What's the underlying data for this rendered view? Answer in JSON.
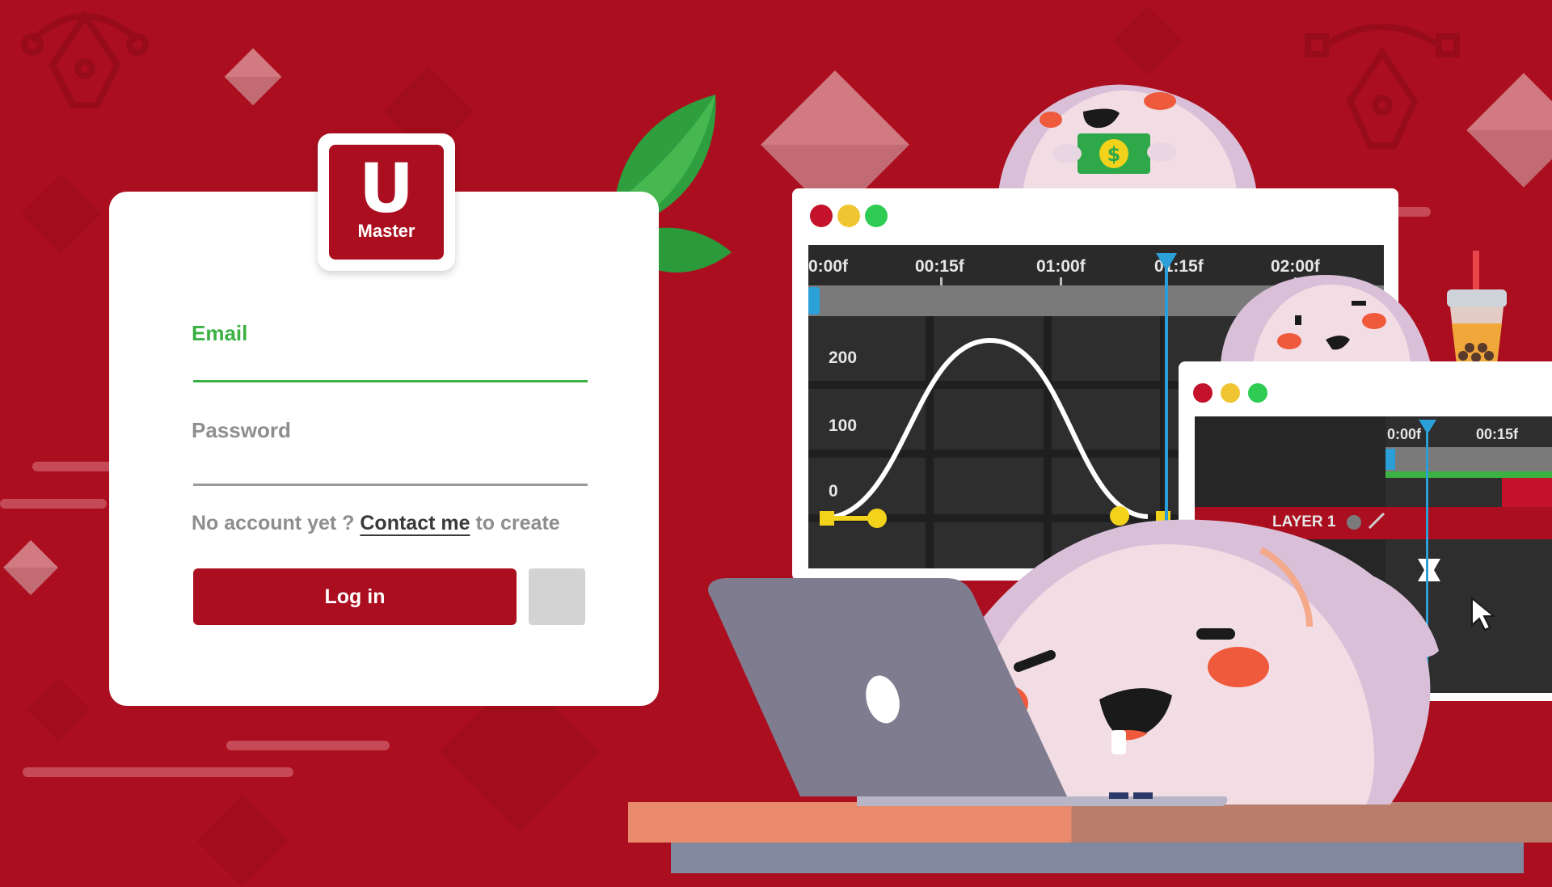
{
  "logo": {
    "letter": "U",
    "word": "Master"
  },
  "form": {
    "email_label": "Email",
    "password_label": "Password",
    "signup_prefix": "No account yet ? ",
    "signup_link": "Contact me",
    "signup_suffix": " to create",
    "login_label": "Log in"
  },
  "timeline_main": {
    "ticks": [
      "0:00f",
      "00:15f",
      "01:00f",
      "01:15f",
      "02:00f"
    ],
    "y_labels": [
      "200",
      "100",
      "0"
    ]
  },
  "timeline_secondary": {
    "ticks": [
      "0:00f",
      "00:15f"
    ],
    "layer_label": "LAYER 1"
  },
  "money_symbol": "$",
  "colors": {
    "brand": "#ab0f1f",
    "accent_green": "#3bb143",
    "playhead": "#2a9fd8",
    "keyframe": "#f2d21b"
  }
}
